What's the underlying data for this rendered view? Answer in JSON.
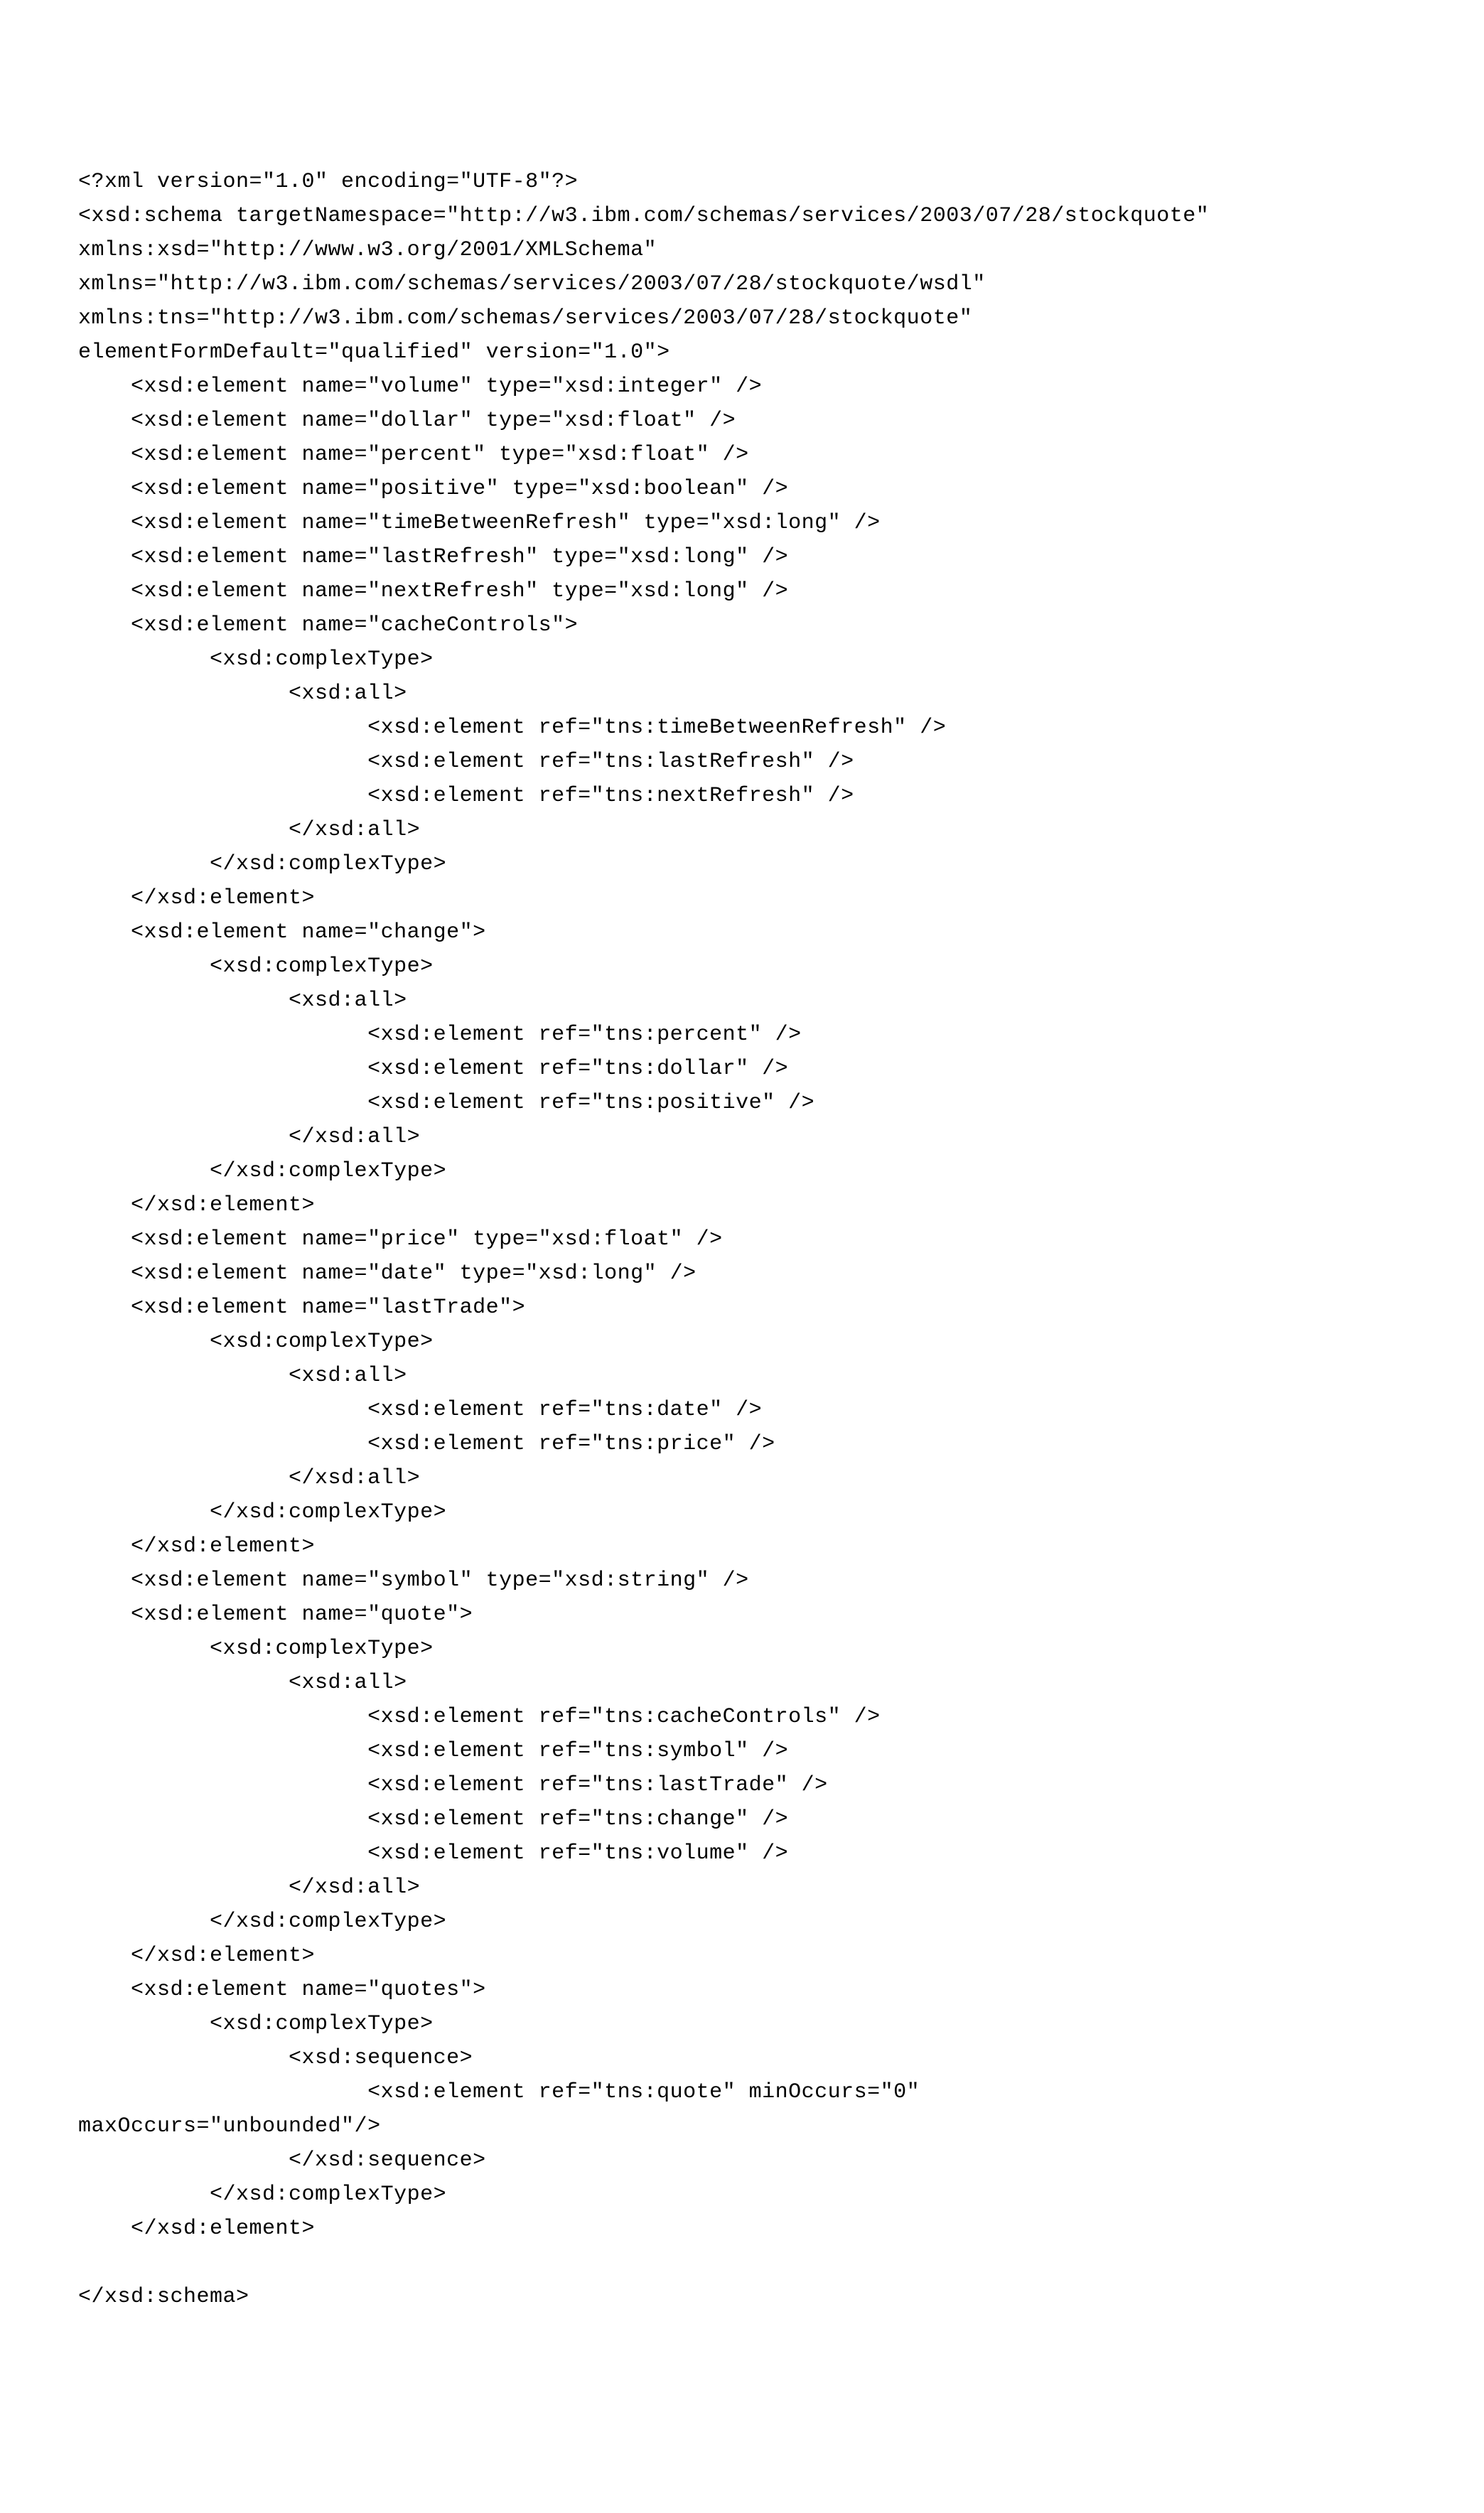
{
  "code": "<?xml version=\"1.0\" encoding=\"UTF-8\"?>\n<xsd:schema targetNamespace=\"http://w3.ibm.com/schemas/services/2003/07/28/stockquote\"\nxmlns:xsd=\"http://www.w3.org/2001/XMLSchema\"\nxmlns=\"http://w3.ibm.com/schemas/services/2003/07/28/stockquote/wsdl\"\nxmlns:tns=\"http://w3.ibm.com/schemas/services/2003/07/28/stockquote\"\nelementFormDefault=\"qualified\" version=\"1.0\">\n    <xsd:element name=\"volume\" type=\"xsd:integer\" />\n    <xsd:element name=\"dollar\" type=\"xsd:float\" />\n    <xsd:element name=\"percent\" type=\"xsd:float\" />\n    <xsd:element name=\"positive\" type=\"xsd:boolean\" />\n    <xsd:element name=\"timeBetweenRefresh\" type=\"xsd:long\" />\n    <xsd:element name=\"lastRefresh\" type=\"xsd:long\" />\n    <xsd:element name=\"nextRefresh\" type=\"xsd:long\" />\n    <xsd:element name=\"cacheControls\">\n          <xsd:complexType>\n                <xsd:all>\n                      <xsd:element ref=\"tns:timeBetweenRefresh\" />\n                      <xsd:element ref=\"tns:lastRefresh\" />\n                      <xsd:element ref=\"tns:nextRefresh\" />\n                </xsd:all>\n          </xsd:complexType>\n    </xsd:element>\n    <xsd:element name=\"change\">\n          <xsd:complexType>\n                <xsd:all>\n                      <xsd:element ref=\"tns:percent\" />\n                      <xsd:element ref=\"tns:dollar\" />\n                      <xsd:element ref=\"tns:positive\" />\n                </xsd:all>\n          </xsd:complexType>\n    </xsd:element>\n    <xsd:element name=\"price\" type=\"xsd:float\" />\n    <xsd:element name=\"date\" type=\"xsd:long\" />\n    <xsd:element name=\"lastTrade\">\n          <xsd:complexType>\n                <xsd:all>\n                      <xsd:element ref=\"tns:date\" />\n                      <xsd:element ref=\"tns:price\" />\n                </xsd:all>\n          </xsd:complexType>\n    </xsd:element>\n    <xsd:element name=\"symbol\" type=\"xsd:string\" />\n    <xsd:element name=\"quote\">\n          <xsd:complexType>\n                <xsd:all>\n                      <xsd:element ref=\"tns:cacheControls\" />\n                      <xsd:element ref=\"tns:symbol\" />\n                      <xsd:element ref=\"tns:lastTrade\" />\n                      <xsd:element ref=\"tns:change\" />\n                      <xsd:element ref=\"tns:volume\" />\n                </xsd:all>\n          </xsd:complexType>\n    </xsd:element>\n    <xsd:element name=\"quotes\">\n          <xsd:complexType>\n                <xsd:sequence>\n                      <xsd:element ref=\"tns:quote\" minOccurs=\"0\"\nmaxOccurs=\"unbounded\"/>\n                </xsd:sequence>\n          </xsd:complexType>\n    </xsd:element>\n\n</xsd:schema>"
}
